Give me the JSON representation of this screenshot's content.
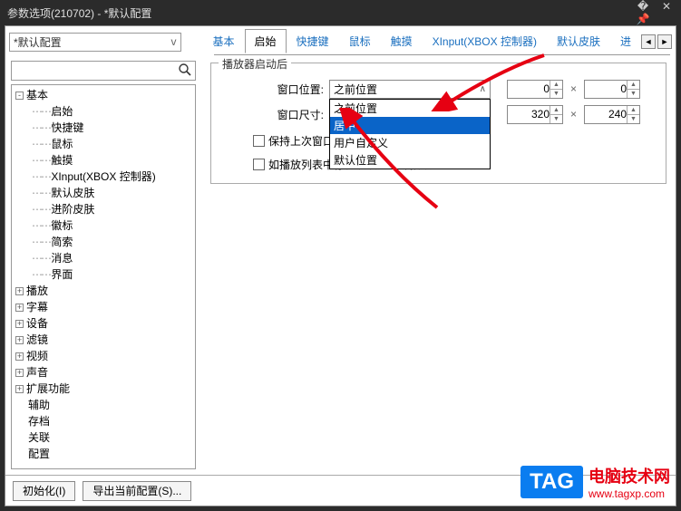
{
  "window": {
    "title": "参数选项(210702) - *默认配置"
  },
  "profile": {
    "selected": "*默认配置",
    "dropdown_glyph": "v"
  },
  "tabs": {
    "items": [
      "基本",
      "启始",
      "快捷键",
      "鼠标",
      "触摸",
      "XInput(XBOX 控制器)",
      "默认皮肤",
      "进"
    ],
    "active_index": 1,
    "nav_left": "◄",
    "nav_right": "►"
  },
  "search": {
    "placeholder": ""
  },
  "tree": {
    "root": "基本",
    "children": [
      "启始",
      "快捷键",
      "鼠标",
      "触摸",
      "XInput(XBOX 控制器)",
      "默认皮肤",
      "进阶皮肤",
      "徽标",
      "简索",
      "消息",
      "界面"
    ],
    "collapsed": [
      "播放",
      "字幕",
      "设备",
      "滤镜",
      "视频",
      "声音",
      "扩展功能",
      "辅助",
      "存档",
      "关联",
      "配置"
    ]
  },
  "group": {
    "legend": "播放器启动后",
    "pos_label": "窗口位置:",
    "pos_value": "之前位置",
    "pos_options": [
      "之前位置",
      "居中",
      "用户自定义",
      "默认位置"
    ],
    "pos_selected_index": 1,
    "size_label": "窗口尺寸:",
    "pos_x": "0",
    "pos_y": "0",
    "size_w": "320",
    "size_h": "240",
    "times": "×",
    "check1": "保持上次窗口状态",
    "check2": "如播放列表中存在该项则立即播放"
  },
  "buttons": {
    "init": "初始化(I)",
    "export": "导出当前配置(S)..."
  },
  "watermark": {
    "tag": "TAG",
    "line1": "电脑技术网",
    "line2": "www.tagxp.com"
  }
}
